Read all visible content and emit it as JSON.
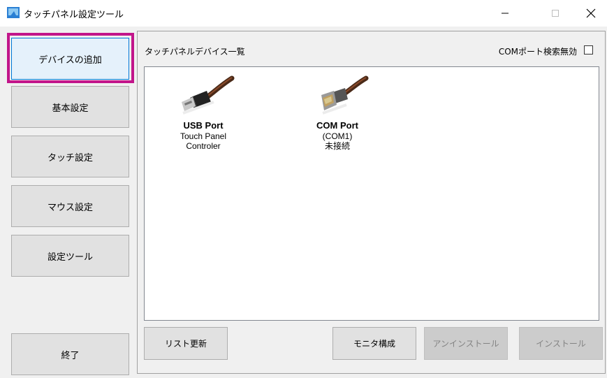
{
  "window": {
    "title": "タッチパネル設定ツール",
    "minimize_glyph": "—",
    "maximize_glyph": "☐",
    "close_glyph": "✕"
  },
  "sidebar": {
    "items": [
      {
        "label": "デバイスの追加",
        "active": true
      },
      {
        "label": "基本設定"
      },
      {
        "label": "タッチ設定"
      },
      {
        "label": "マウス設定"
      },
      {
        "label": "設定ツール"
      }
    ],
    "exit_label": "終了",
    "highlight_color": "#c2158a"
  },
  "panel": {
    "title": "タッチパネルデバイス一覧",
    "com_disable_label": "COMポート検索無効",
    "com_disable_checked": false
  },
  "devices": [
    {
      "name": "USB Port",
      "line1": "Touch Panel",
      "line2": "Controler",
      "icon": "usb-cable-icon"
    },
    {
      "name": "COM Port",
      "line1": "(COM1)",
      "line2": "未接続",
      "icon": "serial-cable-icon"
    }
  ],
  "buttons": {
    "refresh": "リスト更新",
    "monitor_config": "モニタ構成",
    "uninstall": "アンインストール",
    "install": "インストール"
  }
}
